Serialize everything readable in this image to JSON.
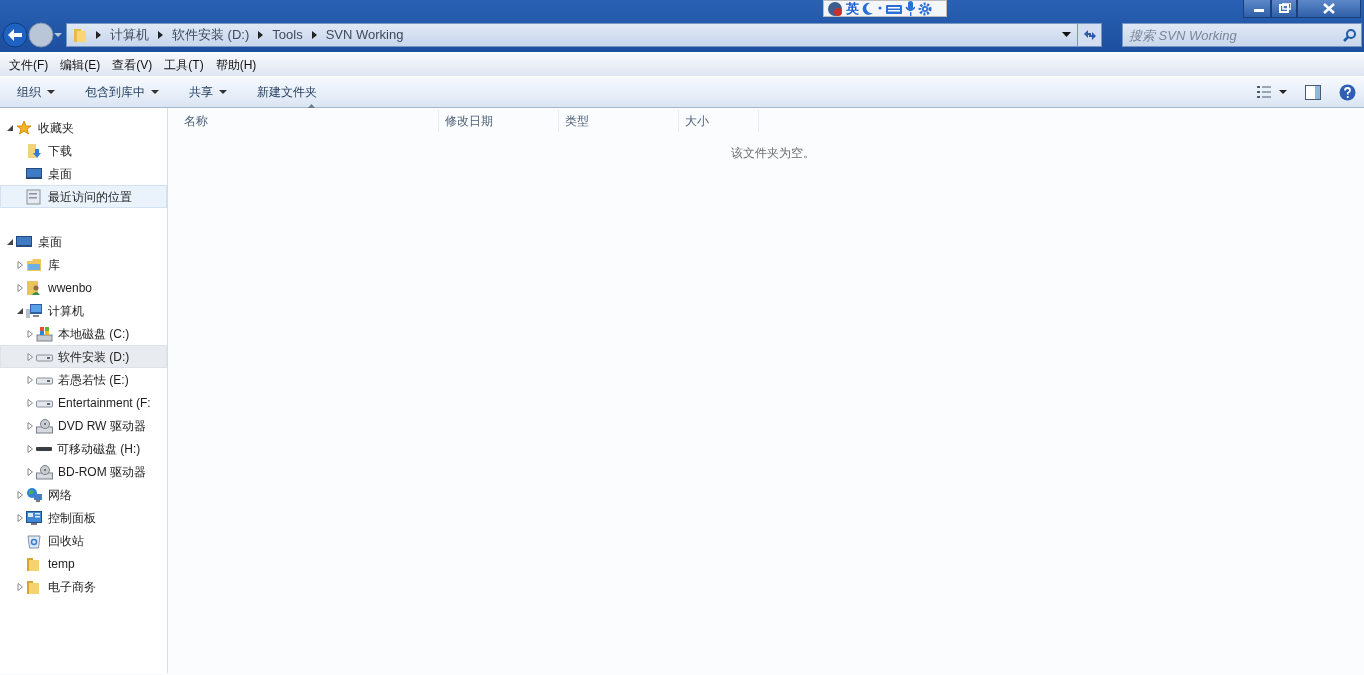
{
  "ime_bar": {
    "mode": "英"
  },
  "address_bar": {
    "crumbs": [
      "计算机",
      "软件安装 (D:)",
      "Tools",
      "SVN Working"
    ]
  },
  "search": {
    "placeholder": "搜索 SVN Working"
  },
  "menu_bar": [
    "文件(F)",
    "编辑(E)",
    "查看(V)",
    "工具(T)",
    "帮助(H)"
  ],
  "toolbar": [
    {
      "label": "组织",
      "dropdown": true
    },
    {
      "label": "包含到库中",
      "dropdown": true
    },
    {
      "label": "共享",
      "dropdown": true
    },
    {
      "label": "新建文件夹",
      "dropdown": false
    }
  ],
  "sidebar": {
    "groups": [
      {
        "label": "收藏夹",
        "kind": "star",
        "expandable": true,
        "expanded": true,
        "selected": false,
        "children": [
          {
            "label": "下载",
            "kind": "download",
            "expandable": false,
            "selected": false
          },
          {
            "label": "桌面",
            "kind": "desktop",
            "expandable": false,
            "selected": false
          },
          {
            "label": "最近访问的位置",
            "kind": "recent",
            "expandable": false,
            "selected": true
          }
        ]
      },
      {
        "label": "桌面",
        "kind": "desktop",
        "expandable": true,
        "expanded": true,
        "selected": false,
        "children": [
          {
            "label": "库",
            "kind": "library",
            "expandable": true,
            "expanded": false,
            "selected": false
          },
          {
            "label": "wwenbo",
            "kind": "user",
            "expandable": true,
            "expanded": false,
            "selected": false
          },
          {
            "label": "计算机",
            "kind": "computer",
            "expandable": true,
            "expanded": true,
            "selected": false,
            "children": [
              {
                "label": "本地磁盘 (C:)",
                "kind": "system-drive",
                "expandable": true,
                "expanded": false,
                "selected": false
              },
              {
                "label": "软件安装 (D:)",
                "kind": "drive",
                "expandable": true,
                "expanded": false,
                "selected": true
              },
              {
                "label": "若愚若怯 (E:)",
                "kind": "drive",
                "expandable": true,
                "expanded": false,
                "selected": false
              },
              {
                "label": "Entertainment (F:",
                "kind": "drive",
                "expandable": true,
                "expanded": false,
                "selected": false
              },
              {
                "label": "DVD RW 驱动器",
                "kind": "optical",
                "expandable": true,
                "expanded": false,
                "selected": false
              },
              {
                "label": "可移动磁盘 (H:)",
                "kind": "usb",
                "expandable": true,
                "expanded": false,
                "selected": false
              },
              {
                "label": "BD-ROM 驱动器",
                "kind": "optical",
                "expandable": true,
                "expanded": false,
                "selected": false
              }
            ]
          },
          {
            "label": "网络",
            "kind": "network",
            "expandable": true,
            "expanded": false,
            "selected": false
          },
          {
            "label": "控制面板",
            "kind": "control-panel",
            "expandable": true,
            "expanded": false,
            "selected": false
          },
          {
            "label": "回收站",
            "kind": "recycle",
            "expandable": false,
            "selected": false
          },
          {
            "label": "temp",
            "kind": "folder",
            "expandable": false,
            "selected": false
          },
          {
            "label": "电子商务",
            "kind": "folder",
            "expandable": true,
            "expanded": false,
            "selected": false
          }
        ]
      }
    ]
  },
  "file_list": {
    "columns": [
      {
        "label": "名称",
        "sorted": true
      },
      {
        "label": "修改日期",
        "sorted": false
      },
      {
        "label": "类型",
        "sorted": false
      },
      {
        "label": "大小",
        "sorted": false
      }
    ],
    "empty_message": "该文件夹为空。"
  }
}
